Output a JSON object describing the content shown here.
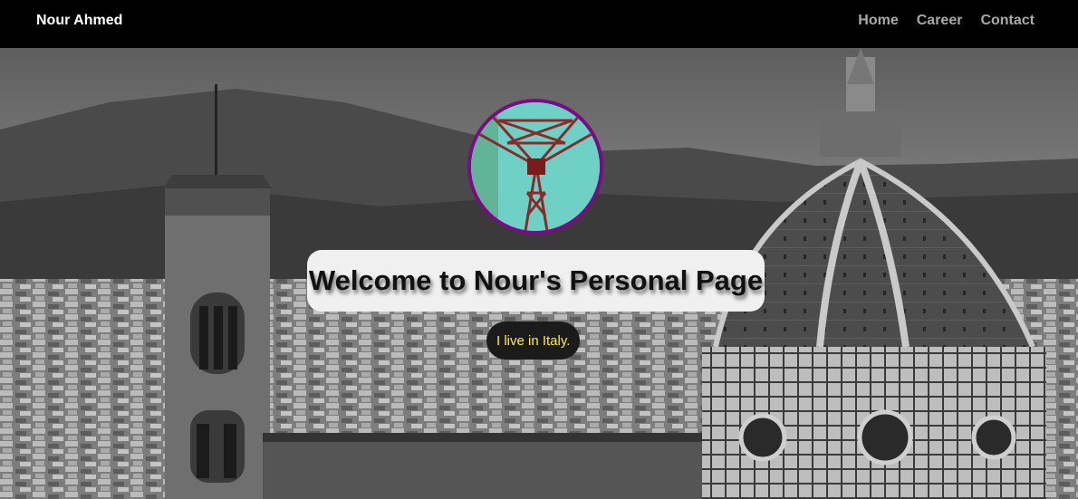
{
  "nav": {
    "brand": "Nour Ahmed",
    "links": [
      "Home",
      "Career",
      "Contact"
    ]
  },
  "hero": {
    "heading": "Welcome to Nour's Personal Page",
    "subtext": "I live in Italy.",
    "subtext_color": "#ffeb3b",
    "avatar_border_color": "#7a0a86"
  }
}
